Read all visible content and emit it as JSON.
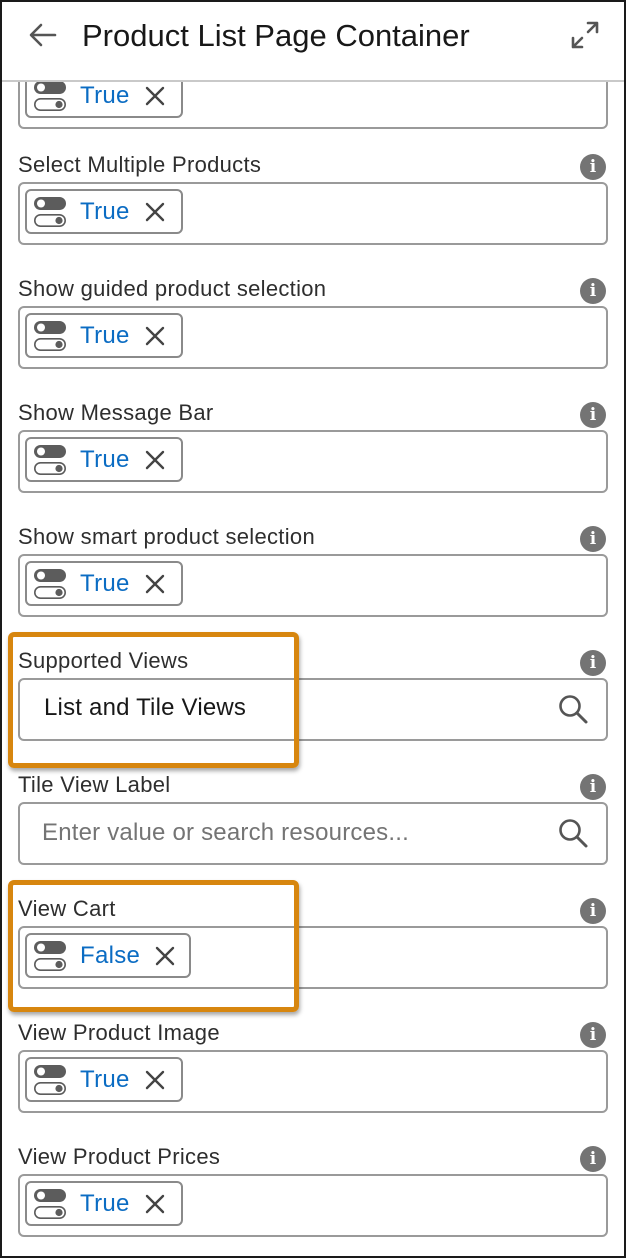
{
  "header": {
    "title": "Product List Page Container",
    "back_icon": "arrow-left-icon",
    "expand_icon": "expand-icon"
  },
  "colors": {
    "value_blue": "#0b6cc3",
    "highlight_orange": "#d7860f",
    "info_grey": "#747474"
  },
  "top_partial": {
    "value": "True"
  },
  "fields": [
    {
      "label": "Select Multiple Products",
      "value": "True"
    },
    {
      "label": "Show guided product selection",
      "value": "True"
    },
    {
      "label": "Show Message Bar",
      "value": "True"
    },
    {
      "label": "Show smart product selection",
      "value": "True"
    },
    {
      "label": "Supported Views",
      "value": "List and Tile Views"
    },
    {
      "label": "Tile View Label",
      "placeholder": "Enter value or search resources..."
    },
    {
      "label": "View Cart",
      "value": "False"
    },
    {
      "label": "View Product Image",
      "value": "True"
    },
    {
      "label": "View Product Prices",
      "value": "True"
    }
  ]
}
